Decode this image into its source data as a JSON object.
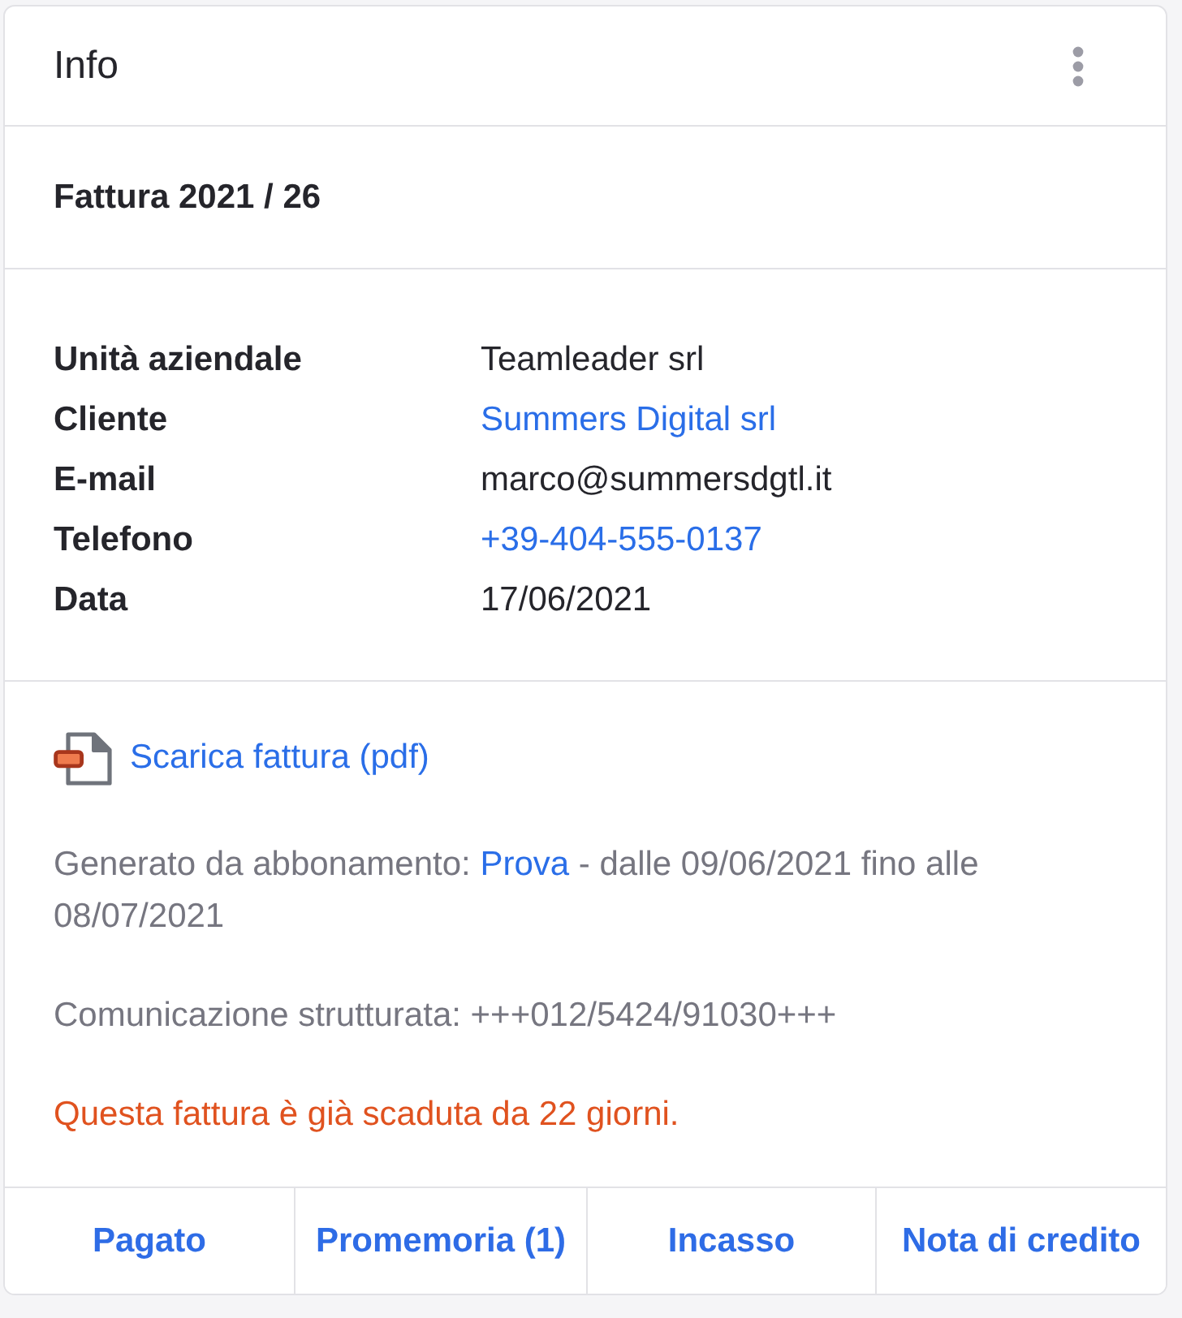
{
  "header": {
    "title": "Info"
  },
  "invoice": {
    "title": "Fattura 2021 / 26"
  },
  "details": [
    {
      "label": "Unità aziendale",
      "value": "Teamleader srl",
      "kind": "text"
    },
    {
      "label": "Cliente",
      "value": "Summers Digital srl",
      "kind": "link"
    },
    {
      "label": "E-mail",
      "value": "marco@summersdgtl.it",
      "kind": "text"
    },
    {
      "label": "Telefono",
      "value": "+39-404-555-0137",
      "kind": "link"
    },
    {
      "label": "Data",
      "value": "17/06/2021",
      "kind": "text"
    }
  ],
  "download": {
    "label": "Scarica fattura (pdf)"
  },
  "subscription": {
    "prefix": "Generato da abbonamento: ",
    "link": "Prova",
    "suffix": " - dalle 09/06/2021 fino alle 08/07/2021"
  },
  "structured_communication": "Comunicazione strutturata: +++012/5424/91030+++",
  "overdue_warning": "Questa fattura è già scaduta da 22 giorni.",
  "actions": [
    "Pagato",
    "Promemoria (1)",
    "Incasso",
    "Nota di credito"
  ]
}
